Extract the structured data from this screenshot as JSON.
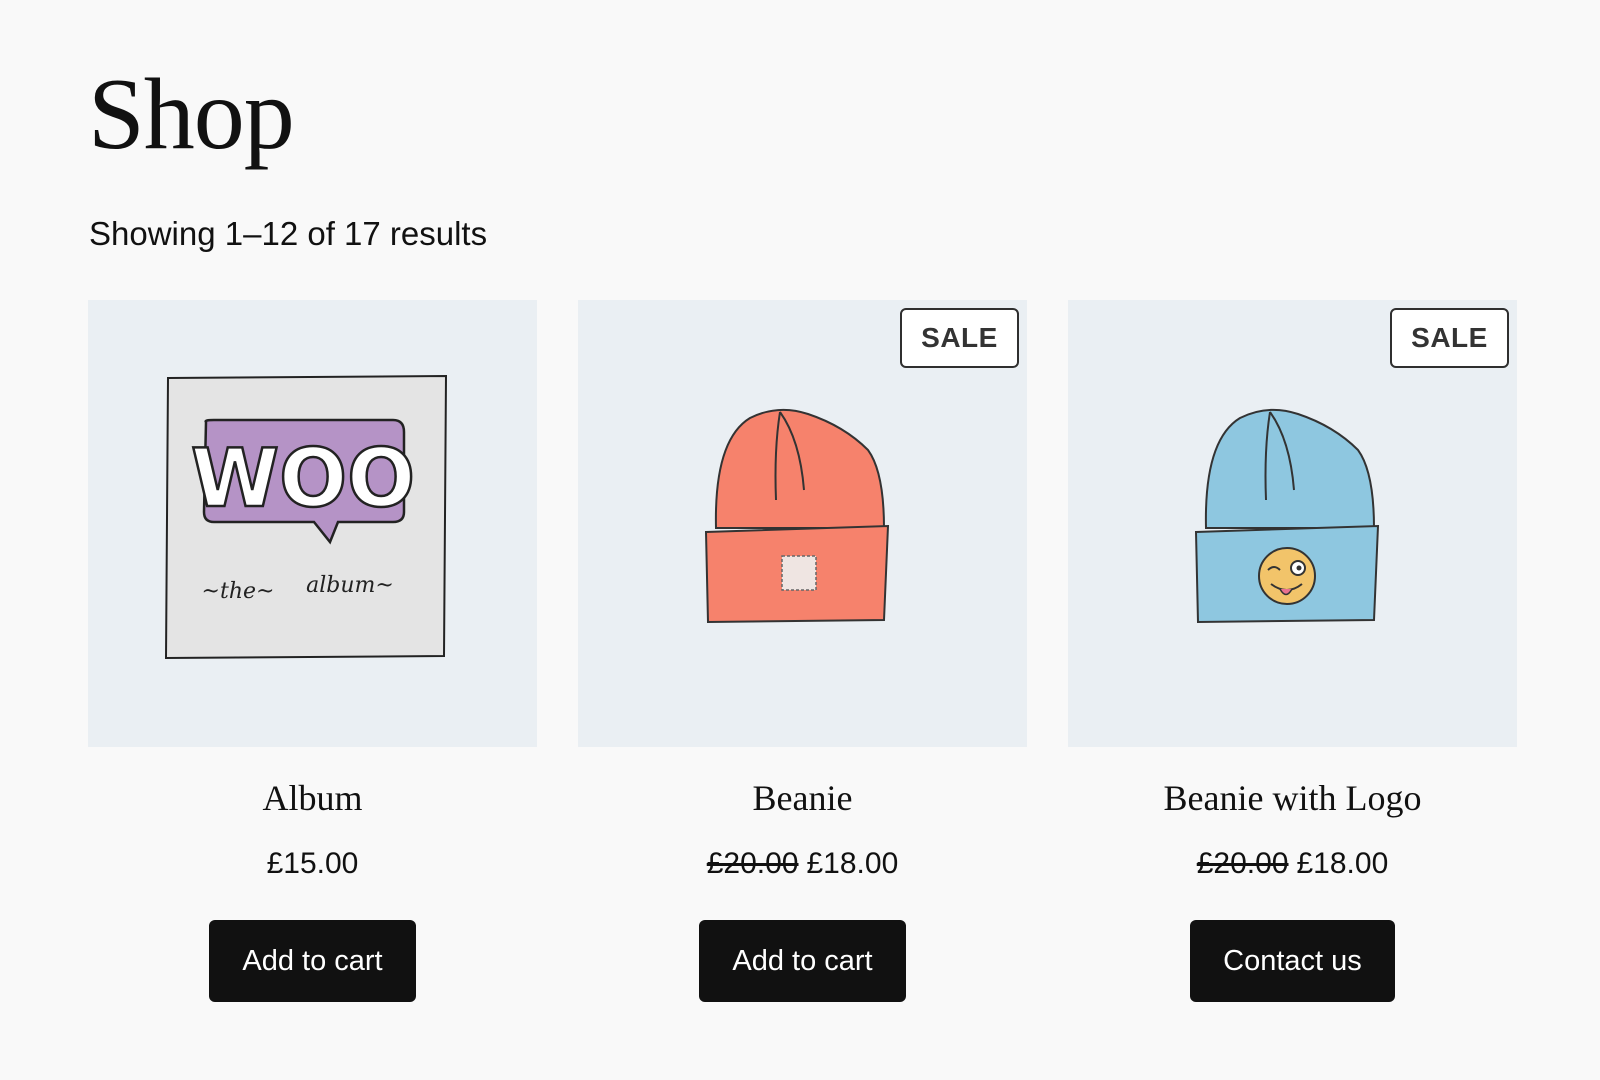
{
  "page": {
    "title": "Shop",
    "result_count": "Showing 1–12 of 17 results"
  },
  "products": [
    {
      "name": "Album",
      "image_icon": "woo-album-cover-icon",
      "price": "£15.00",
      "button_label": "Add to cart"
    },
    {
      "name": "Beanie",
      "image_icon": "orange-beanie-icon",
      "badge": "SALE",
      "regular_price": "£20.00",
      "sale_price": "£18.00",
      "button_label": "Add to cart"
    },
    {
      "name": "Beanie with Logo",
      "image_icon": "blue-beanie-logo-icon",
      "badge": "SALE",
      "regular_price": "£20.00",
      "sale_price": "£18.00",
      "button_label": "Contact us"
    }
  ],
  "colors": {
    "page_background": "#f9f9f9",
    "image_background": "#eaeff3",
    "button_background": "#111111",
    "button_text": "#ffffff"
  }
}
